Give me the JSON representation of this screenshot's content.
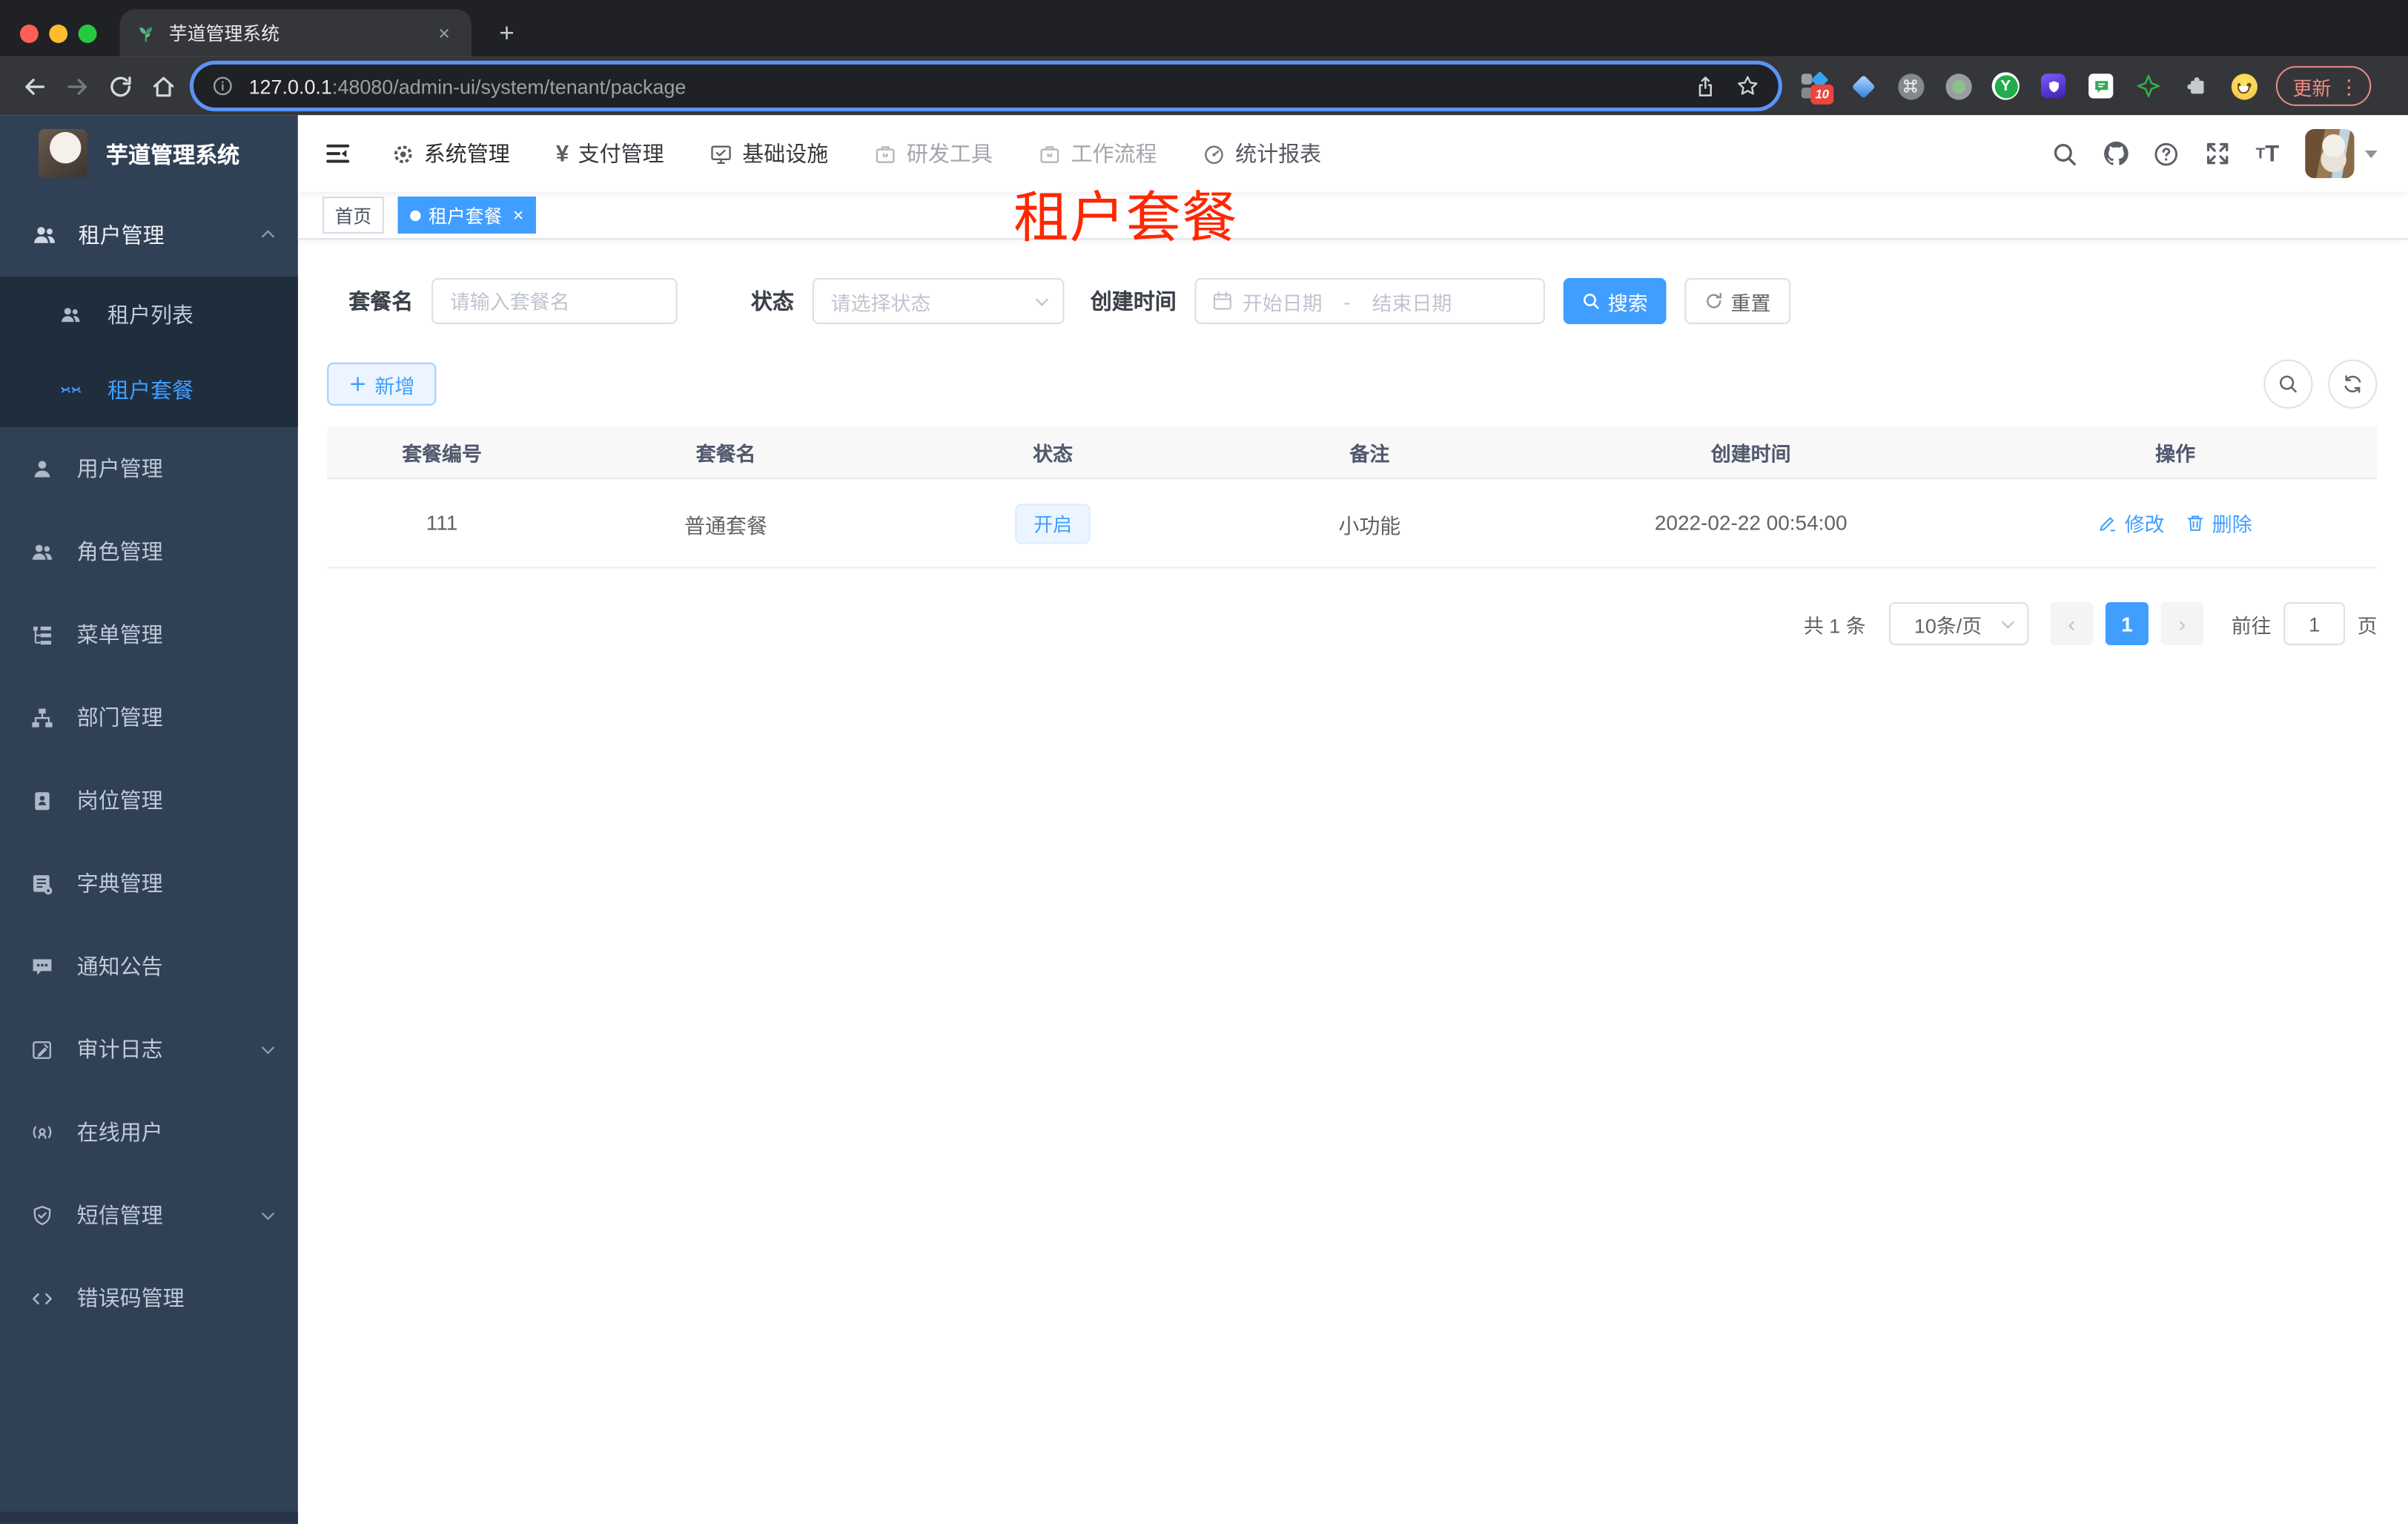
{
  "browser": {
    "tab": {
      "title": "芋道管理系统",
      "close": "×",
      "new_tab": "+"
    },
    "url": {
      "host": "127.0.0.1",
      "rest": ":48080/admin-ui/system/tenant/package"
    },
    "update_label": "更新",
    "menu_dots": "⋮",
    "ext_badge": "10",
    "ext_y_letter": "Y"
  },
  "navbar": {
    "menus": [
      {
        "label": "系统管理",
        "icon": "gear-icon"
      },
      {
        "label": "支付管理",
        "icon": "yen-icon"
      },
      {
        "label": "基础设施",
        "icon": "monitor-icon"
      },
      {
        "label": "研发工具",
        "icon": "briefcase-icon"
      },
      {
        "label": "工作流程",
        "icon": "briefcase-icon"
      },
      {
        "label": "统计报表",
        "icon": "gauge-icon"
      }
    ]
  },
  "sidebar": {
    "app_title": "芋道管理系统",
    "group": {
      "label": "租户管理",
      "icon": "users-icon"
    },
    "subitems": [
      {
        "label": "租户列表",
        "icon": "users-icon"
      },
      {
        "label": "租户套餐",
        "icon": "eye-closed-icon",
        "active": true
      }
    ],
    "items": [
      {
        "label": "用户管理",
        "icon": "user-icon"
      },
      {
        "label": "角色管理",
        "icon": "users-icon"
      },
      {
        "label": "菜单管理",
        "icon": "tree-icon"
      },
      {
        "label": "部门管理",
        "icon": "org-icon"
      },
      {
        "label": "岗位管理",
        "icon": "badge-icon"
      },
      {
        "label": "字典管理",
        "icon": "dictionary-icon"
      },
      {
        "label": "通知公告",
        "icon": "chat-icon"
      },
      {
        "label": "审计日志",
        "icon": "edit-log-icon",
        "expandable": true
      },
      {
        "label": "在线用户",
        "icon": "broadcast-icon"
      },
      {
        "label": "短信管理",
        "icon": "shield-check-icon",
        "expandable": true
      },
      {
        "label": "错误码管理",
        "icon": "code-icon"
      }
    ]
  },
  "tags": {
    "home": "首页",
    "active": "租户套餐",
    "close": "×"
  },
  "annotation": {
    "text": "租户套餐",
    "color": "#ff2600"
  },
  "filters": {
    "name_label": "套餐名",
    "name_placeholder": "请输入套餐名",
    "status_label": "状态",
    "status_placeholder": "请选择状态",
    "date_label": "创建时间",
    "date_start": "开始日期",
    "date_separator": "-",
    "date_end": "结束日期",
    "search": "搜索",
    "reset": "重置"
  },
  "toolbar": {
    "add": "新增"
  },
  "table": {
    "columns": [
      "套餐编号",
      "套餐名",
      "状态",
      "备注",
      "创建时间",
      "操作"
    ],
    "rows": [
      {
        "id": "111",
        "name": "普通套餐",
        "status": "开启",
        "remark": "小功能",
        "created_at": "2022-02-22 00:54:00",
        "edit": "修改",
        "remove": "删除"
      }
    ]
  },
  "pagination": {
    "total": "共 1 条",
    "page_size": "10条/页",
    "prev": "‹",
    "page": "1",
    "next": "›",
    "goto_label": "前往",
    "goto_value": "1",
    "page_unit": "页"
  },
  "colors": {
    "accent": "#409eff",
    "sidebar_bg": "#304156",
    "sidebar_submenu_bg": "#1f2d3d",
    "annotation_red": "#ff2600",
    "status_chip_bg": "#ecf5ff"
  }
}
